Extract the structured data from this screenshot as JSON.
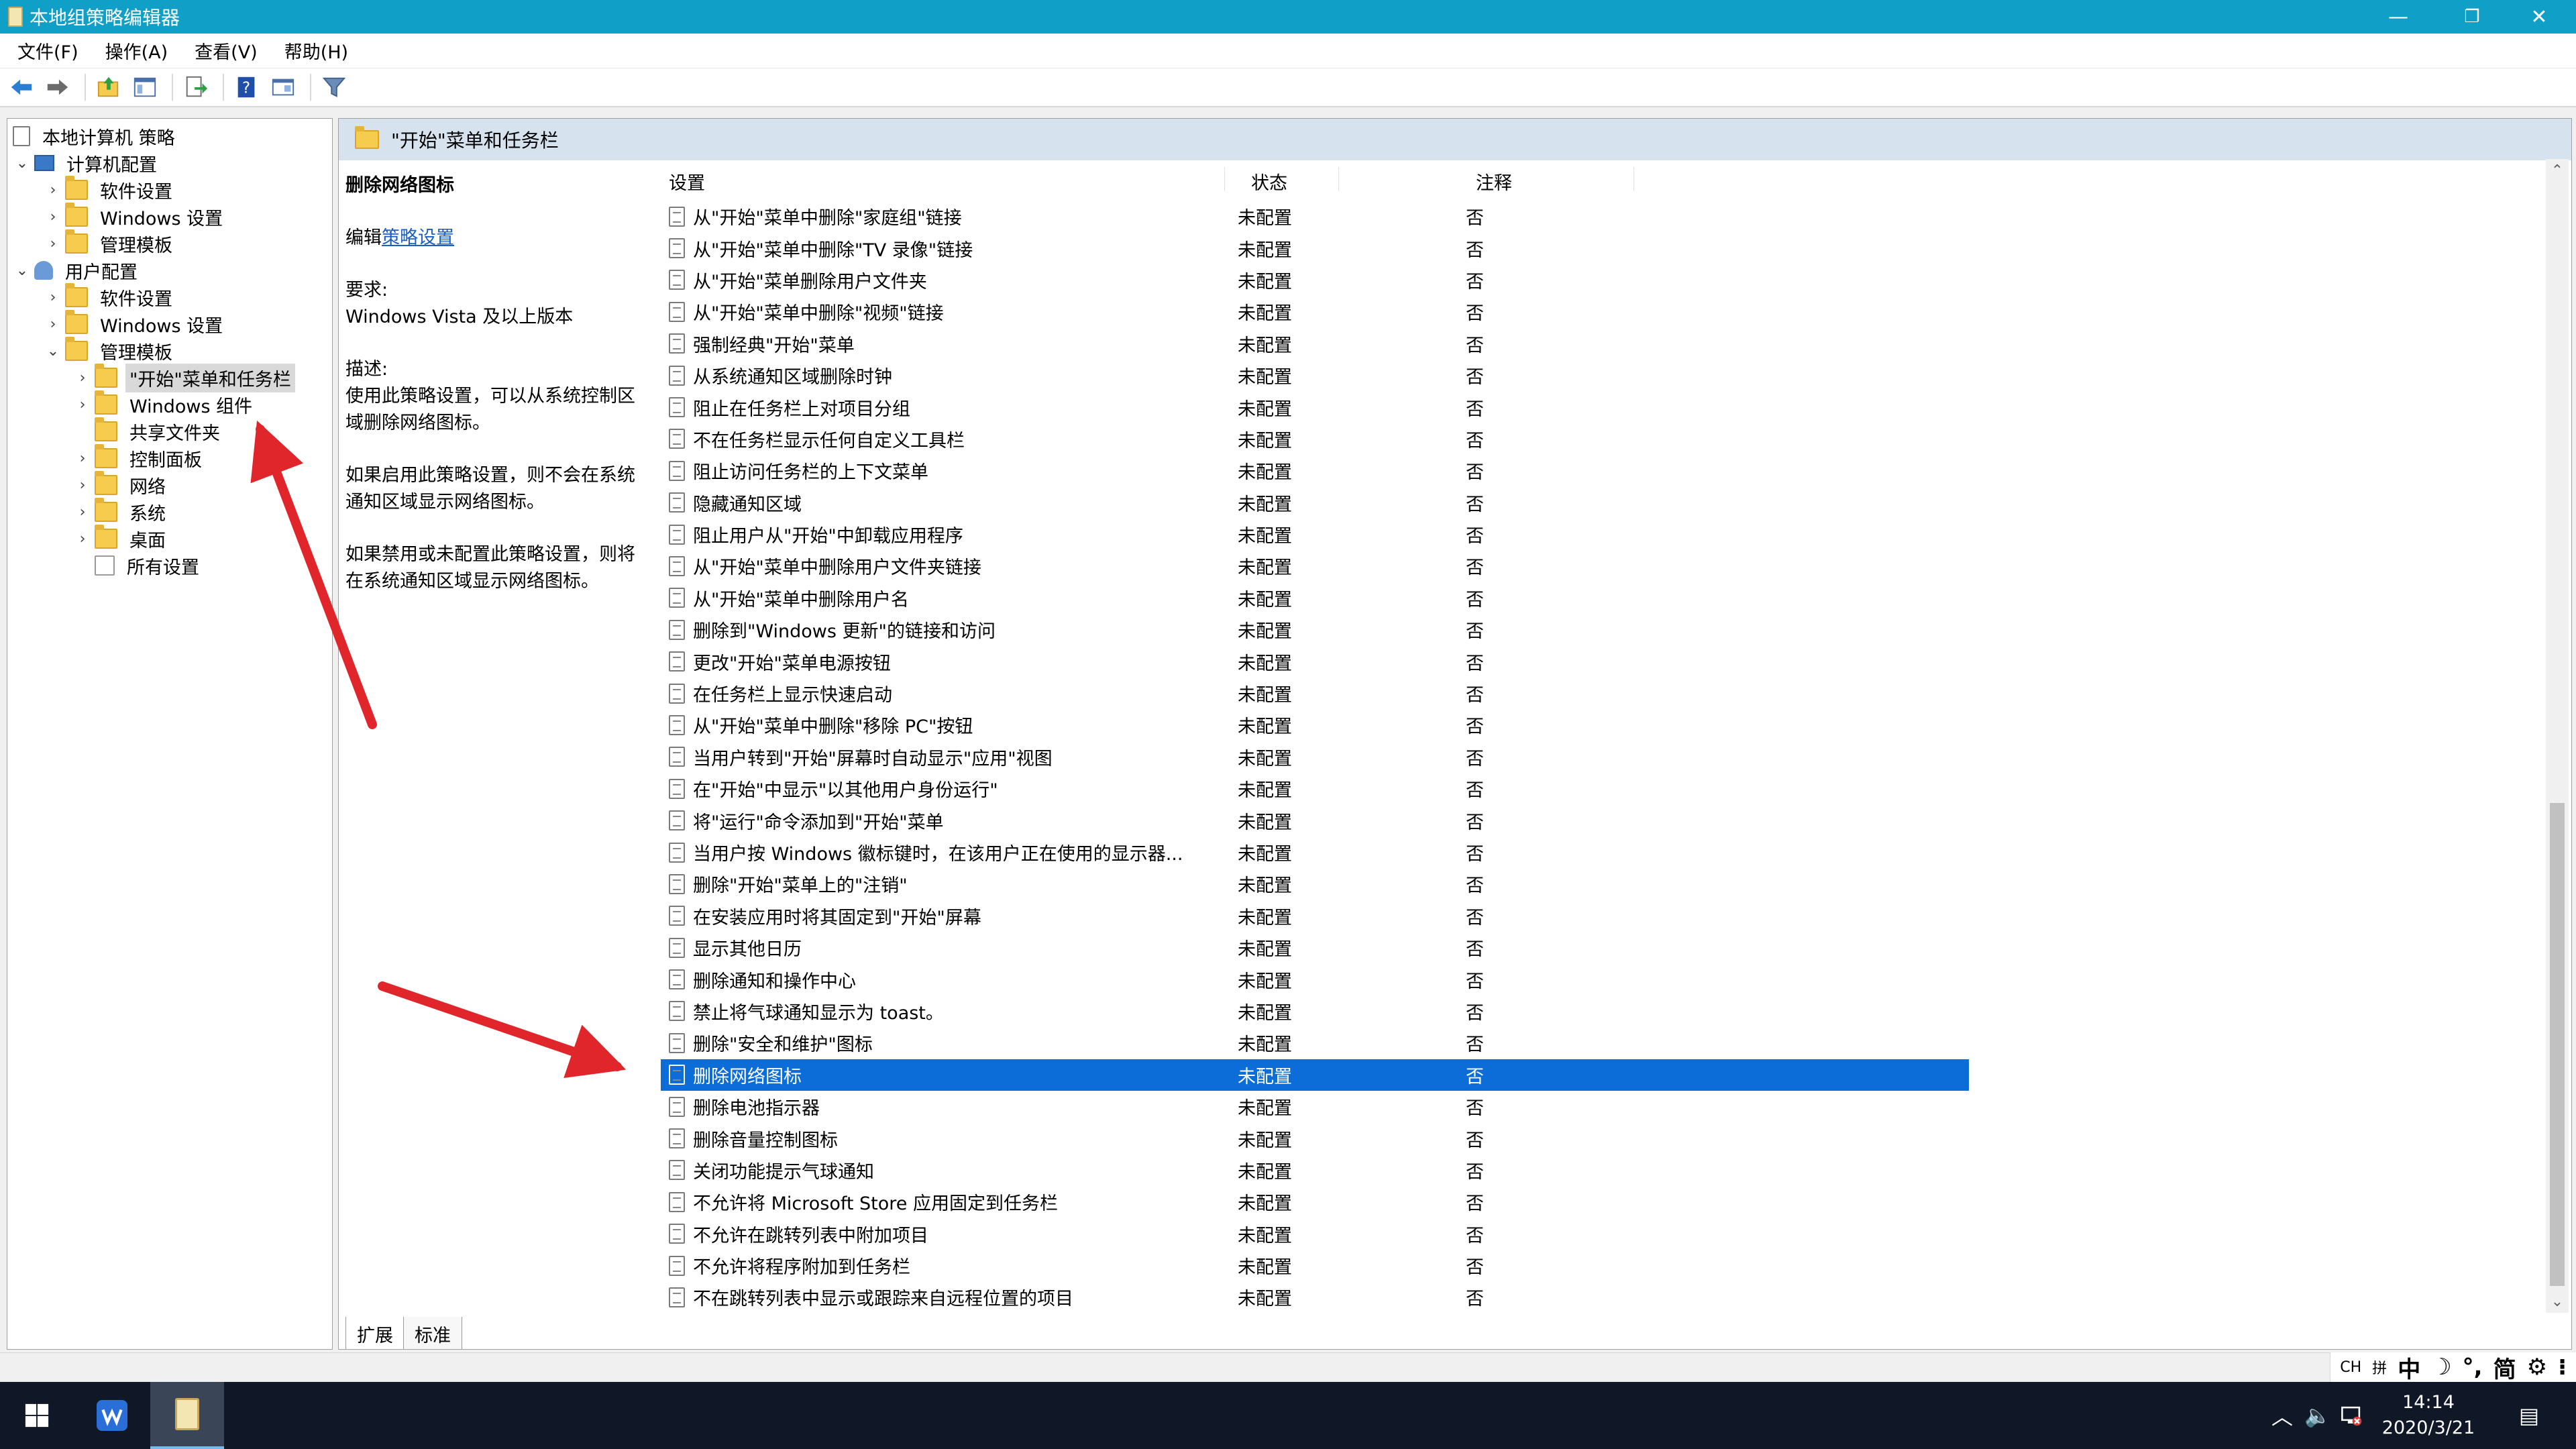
{
  "window": {
    "title": "本地组策略编辑器",
    "minimize_glyph": "—",
    "maximize_glyph": "❐",
    "close_glyph": "✕"
  },
  "menu": [
    "文件(F)",
    "操作(A)",
    "查看(V)",
    "帮助(H)"
  ],
  "toolbar_icons": [
    "back-icon",
    "forward-icon",
    "up-folder-icon",
    "show-hide-tree-icon",
    "export-list-icon",
    "help-icon",
    "properties-icon",
    "filter-icon"
  ],
  "tree": {
    "root": "本地计算机 策略",
    "computer_config": "计算机配置",
    "computer_software": "软件设置",
    "computer_windows": "Windows 设置",
    "computer_admin": "管理模板",
    "user_config": "用户配置",
    "user_software": "软件设置",
    "user_windows": "Windows 设置",
    "user_admin": "管理模板",
    "start_taskbar": "\"开始\"菜单和任务栏",
    "windows_components": "Windows 组件",
    "shared_folders": "共享文件夹",
    "control_panel": "控制面板",
    "network": "网络",
    "system": "系统",
    "desktop": "桌面",
    "all_settings": "所有设置"
  },
  "right": {
    "header": "\"开始\"菜单和任务栏",
    "desc_title": "删除网络图标",
    "edit_prefix": "编辑",
    "edit_link": "策略设置",
    "req_label": "要求:",
    "req_value": "Windows Vista 及以上版本",
    "desc_label": "描述:",
    "desc_p1": "使用此策略设置，可以从系统控制区域删除网络图标。",
    "desc_p2": "如果启用此策略设置，则不会在系统通知区域显示网络图标。",
    "desc_p3": "如果禁用或未配置此策略设置，则将在系统通知区域显示网络图标。",
    "col_setting": "设置",
    "col_state": "状态",
    "col_comment": "注释",
    "tab_extended": "扩展",
    "tab_standard": "标准"
  },
  "policies": [
    {
      "name": "从\"开始\"菜单中删除\"家庭组\"链接",
      "state": "未配置",
      "comment": "否"
    },
    {
      "name": "从\"开始\"菜单中删除\"TV 录像\"链接",
      "state": "未配置",
      "comment": "否"
    },
    {
      "name": "从\"开始\"菜单删除用户文件夹",
      "state": "未配置",
      "comment": "否"
    },
    {
      "name": "从\"开始\"菜单中删除\"视频\"链接",
      "state": "未配置",
      "comment": "否"
    },
    {
      "name": "强制经典\"开始\"菜单",
      "state": "未配置",
      "comment": "否"
    },
    {
      "name": "从系统通知区域删除时钟",
      "state": "未配置",
      "comment": "否"
    },
    {
      "name": "阻止在任务栏上对项目分组",
      "state": "未配置",
      "comment": "否"
    },
    {
      "name": "不在任务栏显示任何自定义工具栏",
      "state": "未配置",
      "comment": "否"
    },
    {
      "name": "阻止访问任务栏的上下文菜单",
      "state": "未配置",
      "comment": "否"
    },
    {
      "name": "隐藏通知区域",
      "state": "未配置",
      "comment": "否"
    },
    {
      "name": "阻止用户从\"开始\"中卸载应用程序",
      "state": "未配置",
      "comment": "否"
    },
    {
      "name": "从\"开始\"菜单中删除用户文件夹链接",
      "state": "未配置",
      "comment": "否"
    },
    {
      "name": "从\"开始\"菜单中删除用户名",
      "state": "未配置",
      "comment": "否"
    },
    {
      "name": "删除到\"Windows 更新\"的链接和访问",
      "state": "未配置",
      "comment": "否"
    },
    {
      "name": "更改\"开始\"菜单电源按钮",
      "state": "未配置",
      "comment": "否"
    },
    {
      "name": "在任务栏上显示快速启动",
      "state": "未配置",
      "comment": "否"
    },
    {
      "name": "从\"开始\"菜单中删除\"移除 PC\"按钮",
      "state": "未配置",
      "comment": "否"
    },
    {
      "name": "当用户转到\"开始\"屏幕时自动显示\"应用\"视图",
      "state": "未配置",
      "comment": "否"
    },
    {
      "name": "在\"开始\"中显示\"以其他用户身份运行\"",
      "state": "未配置",
      "comment": "否"
    },
    {
      "name": "将\"运行\"命令添加到\"开始\"菜单",
      "state": "未配置",
      "comment": "否"
    },
    {
      "name": "当用户按 Windows 徽标键时，在该用户正在使用的显示器...",
      "state": "未配置",
      "comment": "否"
    },
    {
      "name": "删除\"开始\"菜单上的\"注销\"",
      "state": "未配置",
      "comment": "否"
    },
    {
      "name": "在安装应用时将其固定到\"开始\"屏幕",
      "state": "未配置",
      "comment": "否"
    },
    {
      "name": "显示其他日历",
      "state": "未配置",
      "comment": "否"
    },
    {
      "name": "删除通知和操作中心",
      "state": "未配置",
      "comment": "否"
    },
    {
      "name": "禁止将气球通知显示为 toast。",
      "state": "未配置",
      "comment": "否"
    },
    {
      "name": "删除\"安全和维护\"图标",
      "state": "未配置",
      "comment": "否"
    },
    {
      "name": "删除网络图标",
      "state": "未配置",
      "comment": "否",
      "selected": true
    },
    {
      "name": "删除电池指示器",
      "state": "未配置",
      "comment": "否"
    },
    {
      "name": "删除音量控制图标",
      "state": "未配置",
      "comment": "否"
    },
    {
      "name": "关闭功能提示气球通知",
      "state": "未配置",
      "comment": "否"
    },
    {
      "name": "不允许将 Microsoft Store 应用固定到任务栏",
      "state": "未配置",
      "comment": "否"
    },
    {
      "name": "不允许在跳转列表中附加项目",
      "state": "未配置",
      "comment": "否"
    },
    {
      "name": "不允许将程序附加到任务栏",
      "state": "未配置",
      "comment": "否"
    },
    {
      "name": "不在跳转列表中显示或跟踪来自远程位置的项目",
      "state": "未配置",
      "comment": "否"
    }
  ],
  "ime": [
    "CH",
    "拼",
    "中",
    "☽",
    "°,",
    "简",
    "⚙",
    "⁝"
  ],
  "taskbar": {
    "time": "14:14",
    "date": "2020/3/21",
    "volume_glyph": "🔈",
    "chevron_glyph": "︿",
    "notification_glyph": "▤"
  },
  "colors": {
    "titlebar": "#0f9fc7",
    "selection": "#0c6cd8",
    "annotation_arrow": "#e0252b",
    "taskbar": "#101828"
  }
}
